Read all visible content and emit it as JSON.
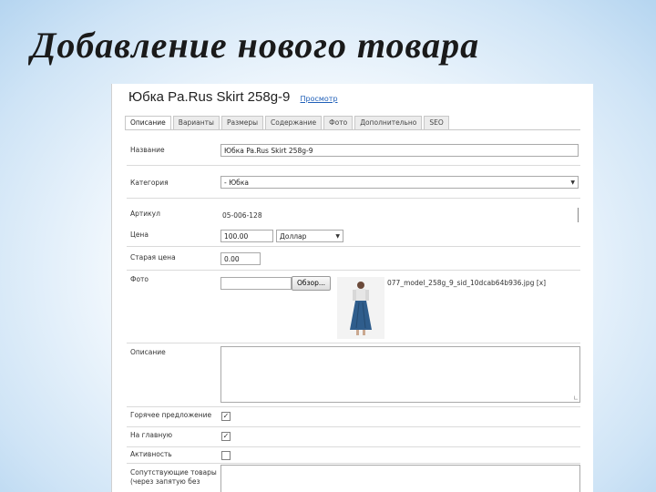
{
  "slide": {
    "title": "Добавление нового товара"
  },
  "header": {
    "product_title": "Юбка Pa.Rus Skirt 258g-9",
    "preview_link": "Просмотр"
  },
  "tabs": [
    "Описание",
    "Варианты",
    "Размеры",
    "Содержание",
    "Фото",
    "Дополнительно",
    "SEO"
  ],
  "form": {
    "name": {
      "label": "Название",
      "value": "Юбка Pa.Rus Skirt 258g-9"
    },
    "category": {
      "label": "Категория",
      "value": "- Юбка"
    },
    "sku": {
      "label": "Артикул",
      "value": "05-006-128"
    },
    "price": {
      "label": "Цена",
      "value": "100.00",
      "currency": "Доллар"
    },
    "old_price": {
      "label": "Старая цена",
      "value": "0.00"
    },
    "photo": {
      "label": "Фото",
      "browse": "Обзор...",
      "filename": "077_model_258g_9_sid_10dcab64b936.jpg",
      "delete": "[x]"
    },
    "description": {
      "label": "Описание",
      "value": ""
    },
    "hot_offer": {
      "label": "Горячее предложение",
      "checked": true
    },
    "on_main": {
      "label": "На главную",
      "checked": true
    },
    "active": {
      "label": "Активность",
      "checked": false
    },
    "related": {
      "label_line1": "Сопутствующие товары",
      "label_line2": "(через запятую без"
    }
  }
}
